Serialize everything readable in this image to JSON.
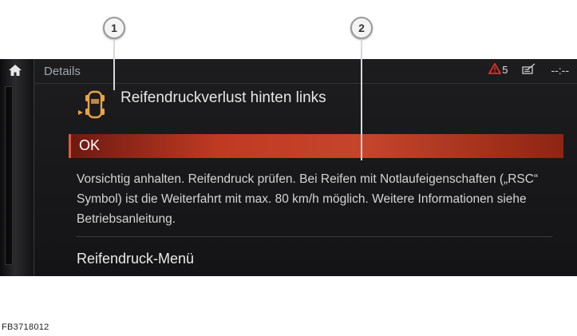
{
  "callouts": {
    "one": "1",
    "two": "2"
  },
  "screen": {
    "title": "Details",
    "status": {
      "warning_count": "5",
      "clock": "--:--"
    },
    "message": "Reifendruckverlust hinten links",
    "ok_label": "OK",
    "description": "Vorsichtig anhalten. Reifendruck prüfen. Bei Reifen mit Notlaufeigenschaften („RSC“ Symbol) ist die Weiterfahrt mit max. 80 km/h möglich. Weitere Informationen siehe Betriebsanleitung.",
    "menu_item": "Reifendruck-Menü"
  },
  "figure_code": "FB3718012",
  "colors": {
    "accent_red": "#c03a22",
    "warning_orange": "#e8a24a",
    "alert_red": "#d9302c"
  },
  "icons": [
    "home-icon",
    "warning-triangle-icon",
    "notepad-icon",
    "tire-pressure-car-icon"
  ]
}
